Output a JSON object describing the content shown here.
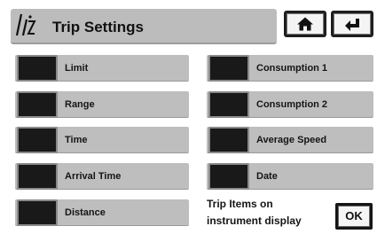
{
  "header": {
    "title": "Trip Settings",
    "home_icon": "home-icon",
    "back_icon": "back-arrow-icon"
  },
  "left_items": [
    {
      "label": "Limit",
      "checked": false
    },
    {
      "label": "Range",
      "checked": false
    },
    {
      "label": "Time",
      "checked": false
    },
    {
      "label": "Arrival Time",
      "checked": false
    },
    {
      "label": "Distance",
      "checked": false
    }
  ],
  "right_items": [
    {
      "label": "Consumption 1",
      "checked": false
    },
    {
      "label": "Consumption 2",
      "checked": false
    },
    {
      "label": "Average Speed",
      "checked": false
    },
    {
      "label": "Date",
      "checked": false
    }
  ],
  "note": {
    "line1": "Trip Items on",
    "line2": "instrument display"
  },
  "ok_label": "OK"
}
